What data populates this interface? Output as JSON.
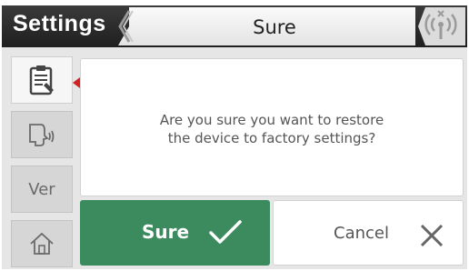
{
  "header": {
    "app_title": "Settings",
    "screen_title": "Sure",
    "back_icon": "chevron-left-icon",
    "status_icon": "wireless-signal-icon"
  },
  "sidebar": {
    "items": [
      {
        "icon": "clipboard-edit-icon",
        "active": true
      },
      {
        "icon": "voice-speaker-icon",
        "active": false
      },
      {
        "label": "Ver",
        "active": false
      },
      {
        "icon": "home-icon",
        "active": false
      }
    ]
  },
  "dialog": {
    "message_line1": "Are you sure you want to restore",
    "message_line2": "the device to factory settings?"
  },
  "buttons": {
    "sure": {
      "label": "Sure",
      "icon": "check-icon"
    },
    "cancel": {
      "label": "Cancel",
      "icon": "close-icon"
    }
  },
  "colors": {
    "header": "#2b2b2b",
    "confirm": "#3c8b5f",
    "active_marker": "#d42020",
    "background": "#e6e6e6"
  }
}
